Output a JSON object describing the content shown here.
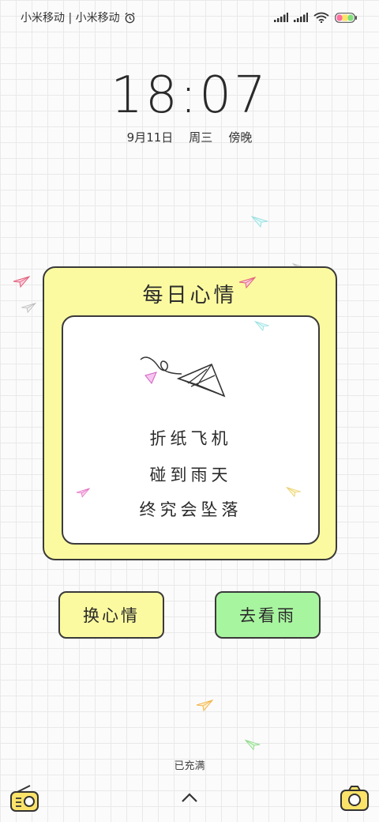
{
  "status_bar": {
    "carrier": "小米移动 | 小米移动",
    "alarm_icon": "alarm-clock-icon",
    "signal_icon": "signal-bars-icon",
    "wifi_icon": "wifi-icon",
    "battery_icon": "battery-icon"
  },
  "lockscreen": {
    "time": "18:07",
    "date": "9月11日",
    "weekday": "周三",
    "period": "傍晚",
    "charge_status": "已充满"
  },
  "mood_card": {
    "title": "每日心情",
    "poem": [
      "折纸飞机",
      "碰到雨天",
      "终究会坠落"
    ]
  },
  "buttons": {
    "change_mood": "换心情",
    "see_rain": "去看雨"
  },
  "bottom": {
    "left_icon": "radio-icon",
    "unlock_icon": "chevron-up-icon",
    "right_icon": "camera-icon"
  },
  "colors": {
    "card_yellow": "#fbfaa0",
    "button_green": "#a8f5a0",
    "outline": "#3a3a3a"
  }
}
